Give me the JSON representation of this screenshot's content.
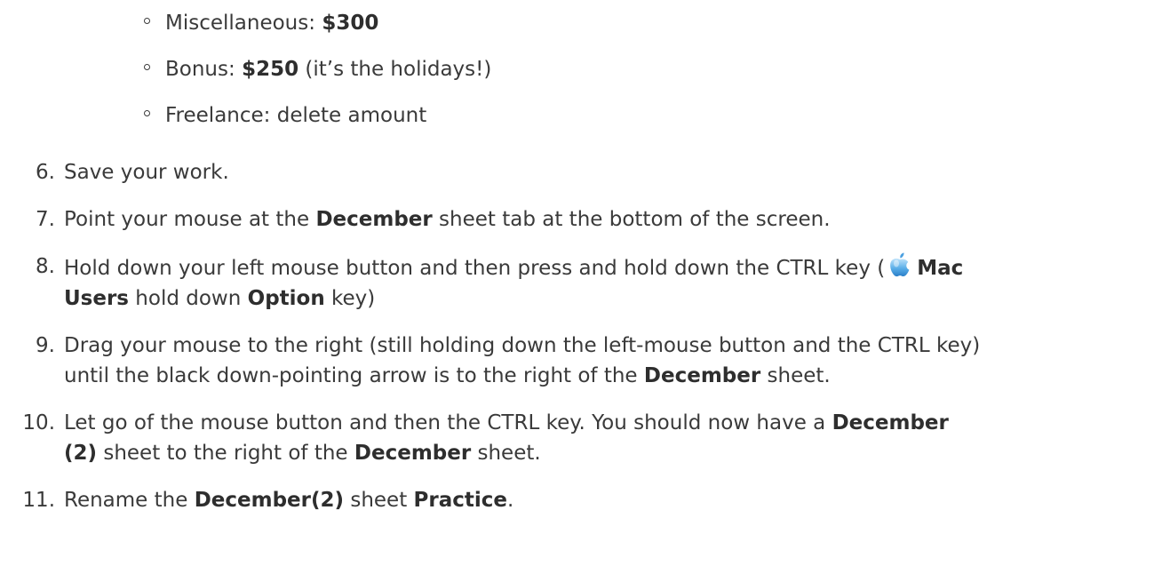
{
  "sub_items": [
    {
      "label": "Miscellaneous: ",
      "bold": "$300",
      "suffix": ""
    },
    {
      "label": "Bonus: ",
      "bold": "$250",
      "suffix": " (it’s the holidays!)"
    },
    {
      "label": "Freelance: delete amount",
      "bold": "",
      "suffix": ""
    }
  ],
  "steps": {
    "s6": {
      "num": "6.",
      "t1": "Save your work."
    },
    "s7": {
      "num": "7.",
      "t1": "Point your mouse at the ",
      "b1": "December",
      "t2": " sheet tab at the bottom of the screen."
    },
    "s8": {
      "num": "8.",
      "t1": "Hold down your left mouse button and then press and hold down the CTRL key (",
      "b1": "Mac",
      "b2": "Users",
      "t2": " hold down ",
      "b3": "Option",
      "t3": " key)",
      "icon": "apple-icon"
    },
    "s9": {
      "num": "9.",
      "t1": "Drag your mouse to the right (still holding down the left-mouse button and the CTRL key)",
      "t2": "until the black down-pointing arrow is to the right of the ",
      "b1": "December",
      "t3": " sheet."
    },
    "s10": {
      "num": "10.",
      "t1": "Let go of the mouse button and then the CTRL key. You should now have a ",
      "b1": "December",
      "b2": "(2)",
      "t2": " sheet to the right of the ",
      "b3": "December",
      "t3": " sheet."
    },
    "s11": {
      "num": "11.",
      "t1": "Rename the ",
      "b1": "December(2)",
      "t2": " sheet ",
      "b2": "Practice",
      "t3": "."
    }
  }
}
